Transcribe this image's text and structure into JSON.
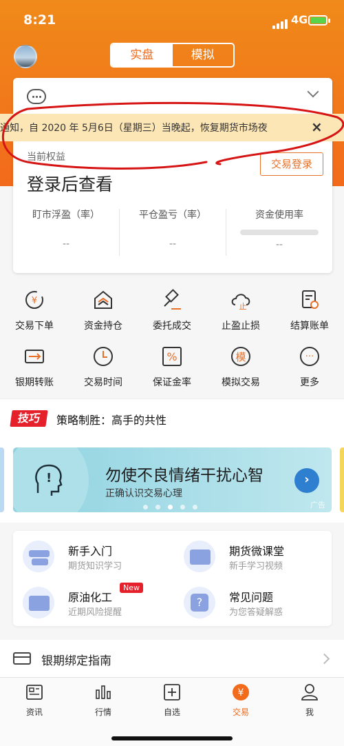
{
  "status_bar": {
    "time": "8:21",
    "network": "4G"
  },
  "segment": {
    "tabs": [
      {
        "label": "实盘",
        "active": true
      },
      {
        "label": "模拟",
        "active": false
      }
    ]
  },
  "notice": {
    "text": "通知，自 2020 年 5月6日（星期三）当晚起，恢复期货市场夜",
    "close": "×"
  },
  "account": {
    "equity_label": "当前权益",
    "equity_value": "登录后查看",
    "login_button": "交易登录",
    "stats": [
      {
        "label": "盯市浮盈（率）",
        "value": "--"
      },
      {
        "label": "平仓盈亏（率）",
        "value": "--"
      },
      {
        "label": "资金使用率",
        "value": "--"
      }
    ]
  },
  "grid": {
    "row1": [
      {
        "label": "交易下单",
        "icon": "yen-refresh-icon"
      },
      {
        "label": "资金持仓",
        "icon": "layers-house-icon"
      },
      {
        "label": "委托成交",
        "icon": "gavel-icon"
      },
      {
        "label": "止盈止损",
        "icon": "cloud-stop-icon"
      },
      {
        "label": "结算账单",
        "icon": "bill-search-icon"
      }
    ],
    "row2": [
      {
        "label": "银期转账",
        "icon": "bank-card-icon"
      },
      {
        "label": "交易时间",
        "icon": "clock-icon"
      },
      {
        "label": "保证金率",
        "icon": "percent-icon"
      },
      {
        "label": "模拟交易",
        "icon": "simulate-icon",
        "glyph": "模"
      },
      {
        "label": "更多",
        "icon": "more-icon",
        "glyph": "···"
      }
    ]
  },
  "tips": {
    "badge": "技巧",
    "title": "策略制胜：高手的共性"
  },
  "banner": {
    "title": "勿使不良情绪干扰心智",
    "subtitle": "正确认识交易心理",
    "ad": "广告",
    "arrow": "›"
  },
  "guide": {
    "items": [
      {
        "title": "新手入门",
        "subtitle": "期货知识学习",
        "icon": "signpost-icon"
      },
      {
        "title": "期货微课堂",
        "subtitle": "新手学习视频",
        "icon": "video-board-icon"
      },
      {
        "title": "原油化工",
        "subtitle": "近期风险提醒",
        "icon": "board-icon",
        "tag": "New"
      },
      {
        "title": "常见问题",
        "subtitle": "为您答疑解惑",
        "icon": "question-icon"
      }
    ]
  },
  "bank_guide": {
    "label": "银期绑定指南"
  },
  "tabbar": {
    "items": [
      {
        "label": "资讯",
        "icon": "news-icon",
        "active": false
      },
      {
        "label": "行情",
        "icon": "chart-bars-icon",
        "active": false
      },
      {
        "label": "自选",
        "icon": "plus-square-icon",
        "active": false
      },
      {
        "label": "交易",
        "icon": "yen-circle-icon",
        "active": true
      },
      {
        "label": "我",
        "icon": "person-icon",
        "active": false
      }
    ],
    "yen": "¥"
  },
  "colors": {
    "brand": "#f26a1b",
    "notice_bg": "#fde6b6",
    "tag_red": "#e5202a"
  }
}
